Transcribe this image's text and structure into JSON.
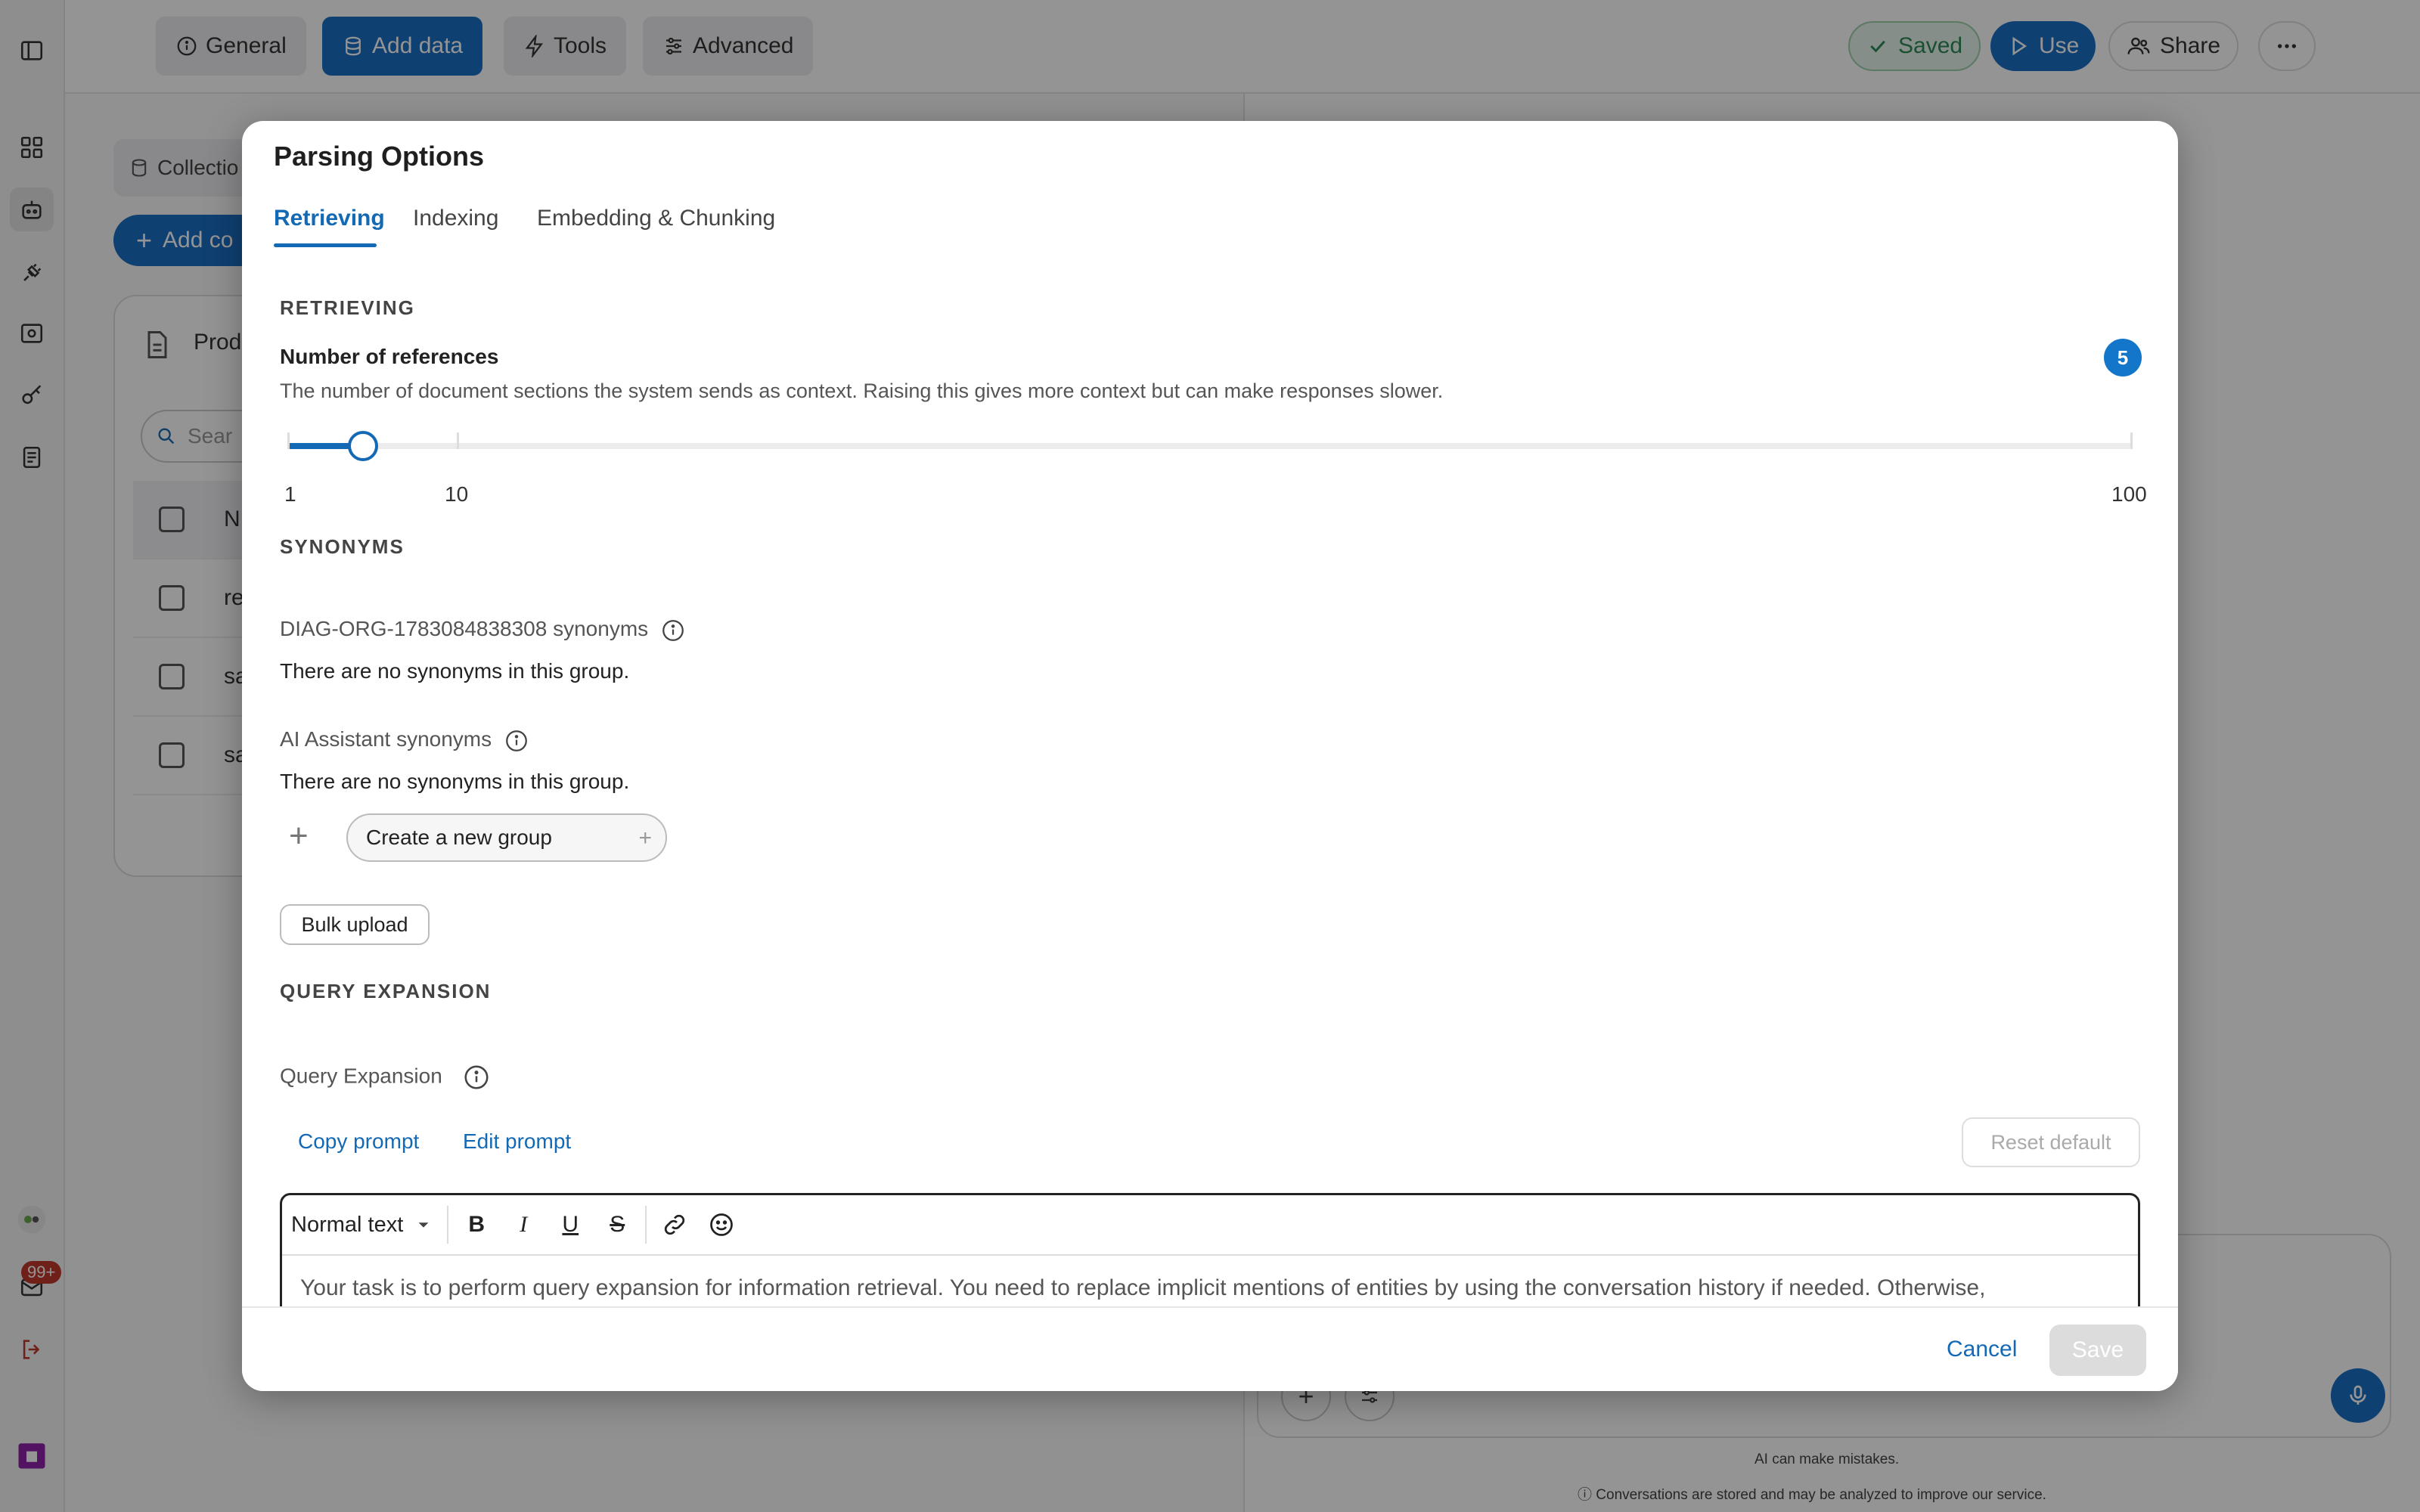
{
  "topbar": {
    "tabs": [
      {
        "label": "General",
        "icon": "info-icon"
      },
      {
        "label": "Add data",
        "icon": "database-icon"
      },
      {
        "label": "Tools",
        "icon": "tools-icon"
      },
      {
        "label": "Advanced",
        "icon": "sliders-icon"
      }
    ],
    "saved_label": "Saved",
    "use_label": "Use",
    "share_label": "Share"
  },
  "leftrail": {
    "notification_count": "99+"
  },
  "background": {
    "collections_label": "Collectio",
    "add_button": "Add co",
    "card_title": "Prod",
    "search_placeholder": "Sear",
    "header_col": "N",
    "rows": [
      "re",
      "sa",
      "sa"
    ],
    "footer_line1": "AI can make mistakes.",
    "footer_line2": "Conversations are stored and may be analyzed to improve our service."
  },
  "modal": {
    "title": "Parsing Options",
    "tabs": [
      "Retrieving",
      "Indexing",
      "Embedding & Chunking"
    ],
    "retrieving": {
      "section_label": "RETRIEVING",
      "setting_title": "Number of references",
      "setting_desc": "The number of document sections the system sends as context. Raising this gives more context but can make responses slower.",
      "value": "5",
      "slider_min": "1",
      "slider_mid": "10",
      "slider_max": "100"
    },
    "synonyms": {
      "section_label": "SYNONYMS",
      "group1_title": "DIAG-ORG-1783084838308 synonyms",
      "group1_empty": "There are no synonyms in this group.",
      "group2_title": "AI Assistant synonyms",
      "group2_empty": "There are no synonyms in this group.",
      "new_group_placeholder": "Create a new group",
      "bulk_upload": "Bulk upload"
    },
    "query_expansion": {
      "section_label": "QUERY EXPANSION",
      "title": "Query Expansion",
      "copy_prompt": "Copy prompt",
      "edit_prompt": "Edit prompt",
      "reset_default": "Reset default",
      "text_style": "Normal text",
      "prompt_text": "Your task is to perform query expansion for information retrieval. You need to replace implicit mentions of entities by using the conversation history if needed. Otherwise,"
    },
    "footer": {
      "cancel": "Cancel",
      "save": "Save"
    }
  },
  "colors": {
    "accent": "#1469b4",
    "badge": "#1376c8",
    "saved_green": "#2e8b57",
    "notification_red": "#c0392b"
  }
}
